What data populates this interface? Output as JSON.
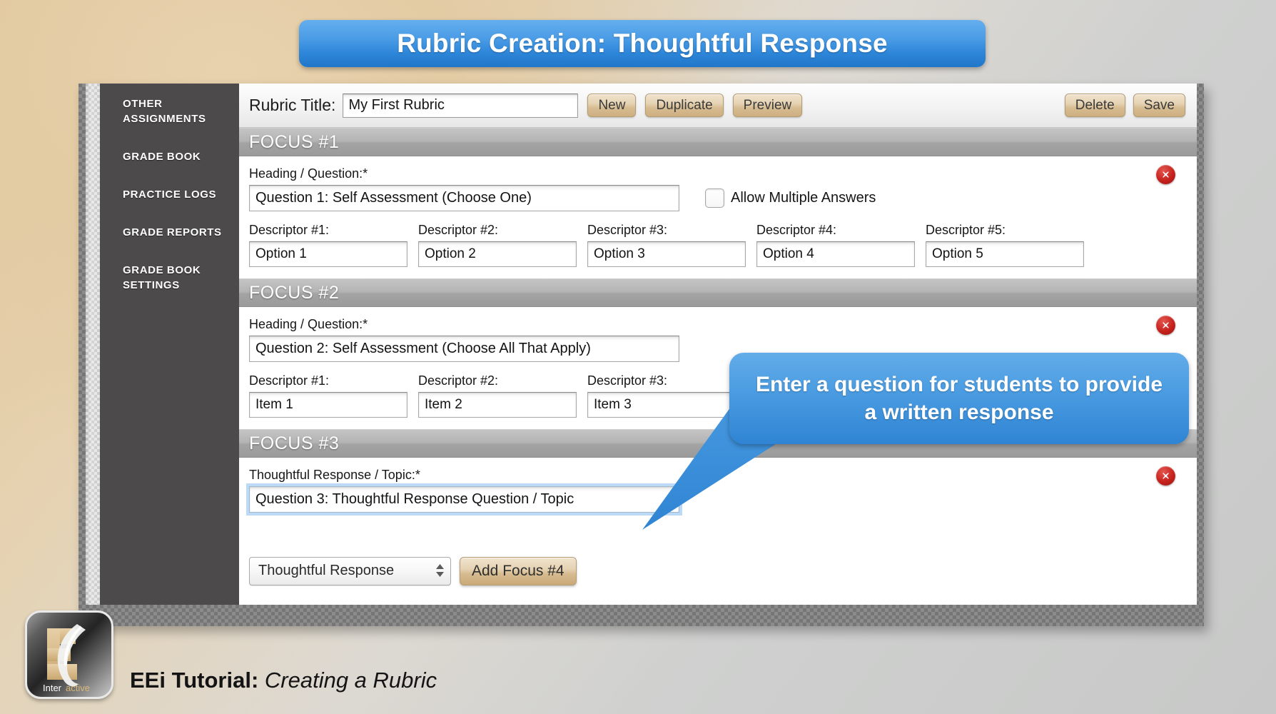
{
  "banner": {
    "title": "Rubric Creation: Thoughtful Response"
  },
  "sidebar": {
    "items": [
      {
        "label": "OTHER ASSIGNMENTS",
        "name": "sidebar-item-other-assignments"
      },
      {
        "label": "GRADE BOOK",
        "name": "sidebar-item-grade-book"
      },
      {
        "label": "PRACTICE LOGS",
        "name": "sidebar-item-practice-logs"
      },
      {
        "label": "GRADE REPORTS",
        "name": "sidebar-item-grade-reports"
      },
      {
        "label": "GRADE BOOK\nSETTINGS",
        "name": "sidebar-item-grade-book-settings"
      }
    ]
  },
  "toolbar": {
    "rubric_title_label": "Rubric Title:",
    "rubric_title_value": "My First Rubric",
    "new_label": "New",
    "duplicate_label": "Duplicate",
    "preview_label": "Preview",
    "delete_label": "Delete",
    "save_label": "Save"
  },
  "focus1": {
    "header": "FOCUS #1",
    "question_label": "Heading / Question:*",
    "question_value": "Question 1: Self Assessment (Choose One)",
    "allow_multiple_label": "Allow Multiple Answers",
    "allow_multiple_checked": false,
    "descriptors": [
      {
        "label": "Descriptor #1:",
        "value": "Option 1"
      },
      {
        "label": "Descriptor #2:",
        "value": "Option 2"
      },
      {
        "label": "Descriptor #3:",
        "value": "Option 3"
      },
      {
        "label": "Descriptor #4:",
        "value": "Option 4"
      },
      {
        "label": "Descriptor #5:",
        "value": "Option 5"
      }
    ]
  },
  "focus2": {
    "header": "FOCUS #2",
    "question_label": "Heading / Question:*",
    "question_value": "Question 2: Self Assessment (Choose All That Apply)",
    "descriptors": [
      {
        "label": "Descriptor #1:",
        "value": "Item 1"
      },
      {
        "label": "Descriptor #2:",
        "value": "Item 2"
      },
      {
        "label": "Descriptor #3:",
        "value": "Item 3"
      }
    ]
  },
  "focus3": {
    "header": "FOCUS #3",
    "question_label": "Thoughtful Response / Topic:*",
    "question_value": "Question 3: Thoughtful Response Question / Topic"
  },
  "bottom": {
    "focus_type_value": "Thoughtful Response",
    "add_focus_label": "Add Focus #4"
  },
  "callout": {
    "text": "Enter a question for students to provide a written response"
  },
  "footer": {
    "caption_bold": "EEi Tutorial:",
    "caption_italic": "Creating a Rubric",
    "logo_word_inter": "Inter",
    "logo_word_active": "active"
  },
  "colors": {
    "accent_blue": "#2f84d3",
    "button_tan": "#d7bd93",
    "sidebar_dark": "#4c4a4a",
    "focus_header_gray": "#a9a9a9",
    "delete_red": "#c6221d"
  }
}
